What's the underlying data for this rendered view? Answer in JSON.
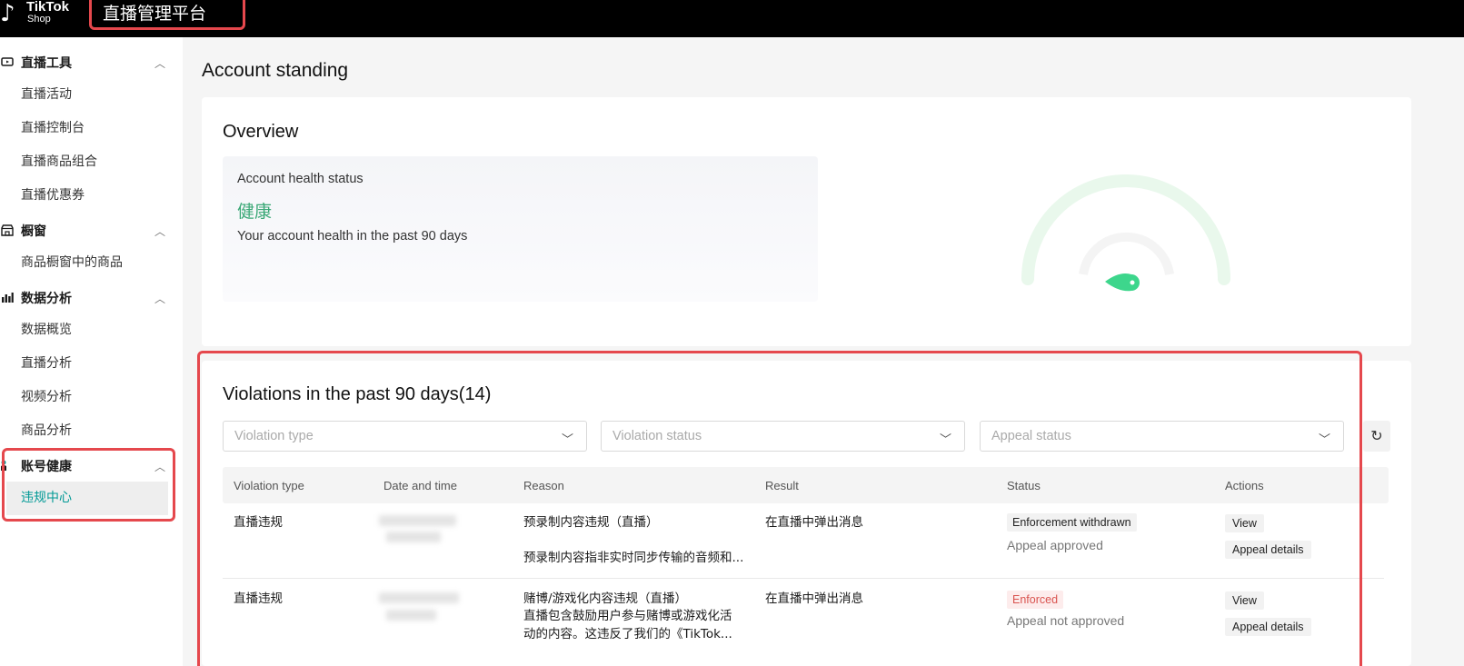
{
  "header": {
    "brand": "TikTok",
    "brand_sub": "Shop",
    "platform_title": "直播管理平台"
  },
  "sidebar": {
    "groups": [
      {
        "label": "直播工具",
        "icon": "live-video-icon",
        "items": [
          "直播活动",
          "直播控制台",
          "直播商品组合",
          "直播优惠券"
        ]
      },
      {
        "label": "橱窗",
        "icon": "storefront-icon",
        "items": [
          "商品橱窗中的商品"
        ]
      },
      {
        "label": "数据分析",
        "icon": "bar-chart-icon",
        "items": [
          "数据概览",
          "直播分析",
          "视频分析",
          "商品分析"
        ]
      },
      {
        "label": "账号健康",
        "icon": "health-icon",
        "items": [
          "违规中心"
        ]
      }
    ],
    "active_item": "违规中心"
  },
  "main": {
    "page_title": "Account standing",
    "overview": {
      "title": "Overview",
      "health_label": "Account health status",
      "health_value": "健康",
      "health_desc": "Your account health in the past 90 days"
    },
    "violations": {
      "title": "Violations in the past 90 days(14)",
      "filters": {
        "violation_type": "Violation type",
        "violation_status": "Violation status",
        "appeal_status": "Appeal status"
      },
      "columns": [
        "Violation type",
        "Date and time",
        "Reason",
        "Result",
        "Status",
        "Actions"
      ],
      "rows": [
        {
          "type": "直播违规",
          "reason_line1": "预录制内容违规（直播）",
          "reason_line2": "预录制内容指非实时同步传输的音频和...",
          "result": "在直播中弹出消息",
          "status_tag": "Enforcement withdrawn",
          "status_sub": "Appeal approved",
          "action_view": "View",
          "action_appeal": "Appeal details"
        },
        {
          "type": "直播违规",
          "reason_line1": "赌博/游戏化内容违规（直播）",
          "reason_line2": "直播包含鼓励用户参与赌博或游戏化活",
          "reason_line3": "动的内容。这违反了我们的《TikTok...",
          "result": "在直播中弹出消息",
          "status_tag": "Enforced",
          "status_sub": "Appeal not approved",
          "action_view": "View",
          "action_appeal": "Appeal details"
        }
      ]
    }
  },
  "colors": {
    "accent": "#009995",
    "healthy": "#3aa876",
    "highlight": "#e5484d",
    "enforced": "#d9534f"
  }
}
